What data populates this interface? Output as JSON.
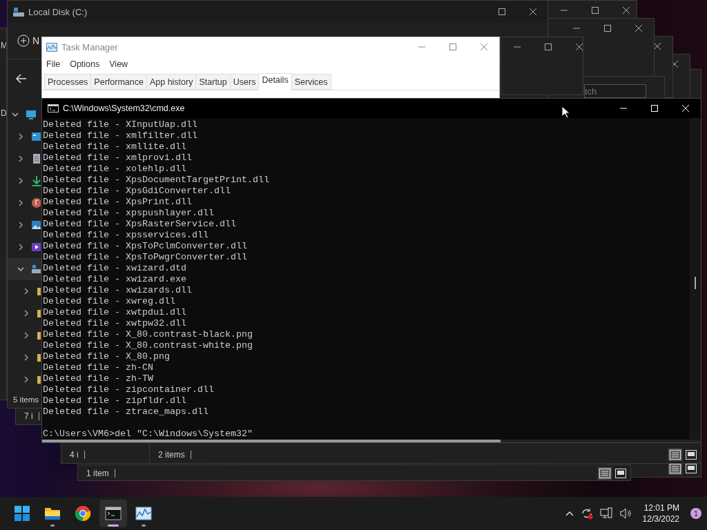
{
  "left_window": {
    "texts": [
      "M",
      "D"
    ]
  },
  "background_windows": [
    {
      "status": "7 i"
    },
    {
      "status": "4 i"
    },
    {
      "status": "2 items"
    },
    {
      "status": "1 item"
    }
  ],
  "search_field": {
    "placeholder": "tch"
  },
  "explorer": {
    "title": "Local Disk (C:)",
    "new_button": "N",
    "status": "5 items",
    "nav_tree": [
      {
        "kind": "pc",
        "expanded": true,
        "selected": false,
        "children": [
          {
            "kind": "desktop",
            "expanded": false,
            "selected": false
          },
          {
            "kind": "documents",
            "expanded": false,
            "selected": false
          },
          {
            "kind": "downloads",
            "expanded": false,
            "selected": false
          },
          {
            "kind": "music",
            "expanded": false,
            "selected": false
          },
          {
            "kind": "pictures",
            "expanded": false,
            "selected": false
          },
          {
            "kind": "videos",
            "expanded": false,
            "selected": false
          },
          {
            "kind": "drive",
            "expanded": true,
            "selected": true,
            "children": [
              {
                "kind": "folder",
                "expanded": false,
                "selected": false
              },
              {
                "kind": "folder",
                "expanded": false,
                "selected": false
              },
              {
                "kind": "folder",
                "expanded": false,
                "selected": false
              },
              {
                "kind": "folder",
                "expanded": false,
                "selected": false
              },
              {
                "kind": "folder",
                "expanded": false,
                "selected": false
              }
            ]
          }
        ]
      }
    ]
  },
  "task_manager": {
    "title": "Task Manager",
    "menu": [
      "File",
      "Options",
      "View"
    ],
    "tabs": [
      {
        "label": "Processes",
        "selected": false
      },
      {
        "label": "Performance",
        "selected": false
      },
      {
        "label": "App history",
        "selected": false
      },
      {
        "label": "Startup",
        "selected": false
      },
      {
        "label": "Users",
        "selected": false
      },
      {
        "label": "Details",
        "selected": true
      },
      {
        "label": "Services",
        "selected": false
      }
    ]
  },
  "cmd": {
    "title": "C:\\Windows\\System32\\cmd.exe",
    "lines": [
      "Deleted file - XInputUap.dll",
      "Deleted file - xmlfilter.dll",
      "Deleted file - xmllite.dll",
      "Deleted file - xmlprovi.dll",
      "Deleted file - xolehlp.dll",
      "Deleted file - XpsDocumentTargetPrint.dll",
      "Deleted file - XpsGdiConverter.dll",
      "Deleted file - XpsPrint.dll",
      "Deleted file - xpspushlayer.dll",
      "Deleted file - XpsRasterService.dll",
      "Deleted file - xpsservices.dll",
      "Deleted file - XpsToPclmConverter.dll",
      "Deleted file - XpsToPwgrConverter.dll",
      "Deleted file - xwizard.dtd",
      "Deleted file - xwizard.exe",
      "Deleted file - xwizards.dll",
      "Deleted file - xwreg.dll",
      "Deleted file - xwtpdui.dll",
      "Deleted file - xwtpw32.dll",
      "Deleted file - X_80.contrast-black.png",
      "Deleted file - X_80.contrast-white.png",
      "Deleted file - X_80.png",
      "Deleted file - zh-CN",
      "Deleted file - zh-TW",
      "Deleted file - zipcontainer.dll",
      "Deleted file - zipfldr.dll",
      "Deleted file - ztrace_maps.dll"
    ],
    "prompt": "C:\\Users\\VM6>del \"C:\\Windows\\System32\""
  },
  "taskbar": {
    "apps": [
      {
        "kind": "start",
        "running": false,
        "selected": false
      },
      {
        "kind": "explorer",
        "running": true,
        "selected": false
      },
      {
        "kind": "browser",
        "running": false,
        "selected": false
      },
      {
        "kind": "terminal",
        "running": true,
        "selected": true
      },
      {
        "kind": "task_manager",
        "running": true,
        "selected": false
      }
    ],
    "time": "12:01 PM",
    "date": "12/3/2022",
    "notifications": "1"
  }
}
